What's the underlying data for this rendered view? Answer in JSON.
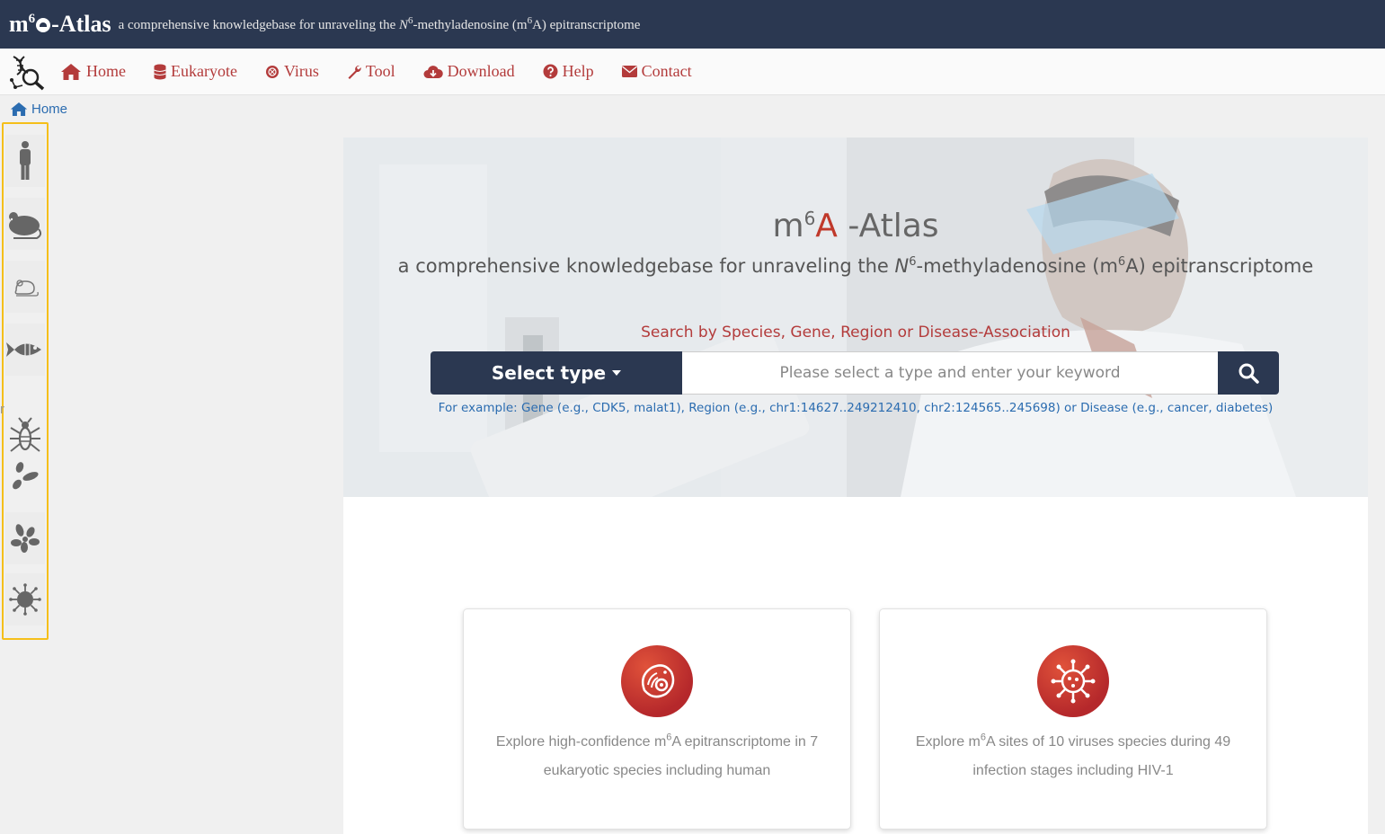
{
  "header": {
    "brand_pre": "m",
    "brand_sup": "6",
    "brand_post": "-Atlas",
    "tagline_pre": "a comprehensive knowledgebase for unraveling the ",
    "tagline_n": "N",
    "tagline_sup": "6",
    "tagline_mid": "-methyladenosine (m",
    "tagline_sup2": "6",
    "tagline_post": "A) epitranscriptome"
  },
  "nav": {
    "items": [
      {
        "label": "Home",
        "icon": "home-icon"
      },
      {
        "label": "Eukaryote",
        "icon": "database-icon"
      },
      {
        "label": "Virus",
        "icon": "virus-icon"
      },
      {
        "label": "Tool",
        "icon": "wrench-icon"
      },
      {
        "label": "Download",
        "icon": "cloud-download-icon"
      },
      {
        "label": "Help",
        "icon": "question-icon"
      },
      {
        "label": "Contact",
        "icon": "envelope-icon"
      }
    ]
  },
  "breadcrumb": {
    "label": "Home"
  },
  "sidebar": {
    "items": [
      "human-icon",
      "mouse-icon",
      "rat-icon",
      "zebrafish-icon",
      "fly-icon",
      "yeast-icon",
      "arabidopsis-icon",
      "virus-icon"
    ],
    "stray_text": "r"
  },
  "hero": {
    "title_m": "m",
    "title_sup": "6",
    "title_a": "A",
    "title_rest": " -Atlas",
    "sub_pre": "a comprehensive knowledgebase for unraveling the ",
    "sub_n": "N",
    "sub_sup": "6",
    "sub_mid": "-methyladenosine (m",
    "sub_sup2": "6",
    "sub_post": "A) epitranscriptome",
    "hint": "Search by Species, Gene, Region or Disease-Association",
    "select_label": "Select type",
    "search_placeholder": "Please select a type and enter your keyword",
    "example": "For example: Gene (e.g., CDK5, malat1), Region (e.g., chr1:14627..249212410, chr2:124565..245698) or Disease (e.g., cancer, diabetes)"
  },
  "cards": [
    {
      "pre": "Explore high-confidence m",
      "sup": "6",
      "post": "A epitranscriptome in 7 eukaryotic species including human",
      "icon": "cell-icon"
    },
    {
      "pre": "Explore m",
      "sup": "6",
      "post": "A sites of 10 viruses species during 49 infection stages including HIV-1",
      "icon": "virus-icon"
    }
  ],
  "colors": {
    "navy": "#2b3851",
    "red": "#b33b3b",
    "link": "#2b6cb0",
    "sidebar_border": "#f5bf1a"
  }
}
